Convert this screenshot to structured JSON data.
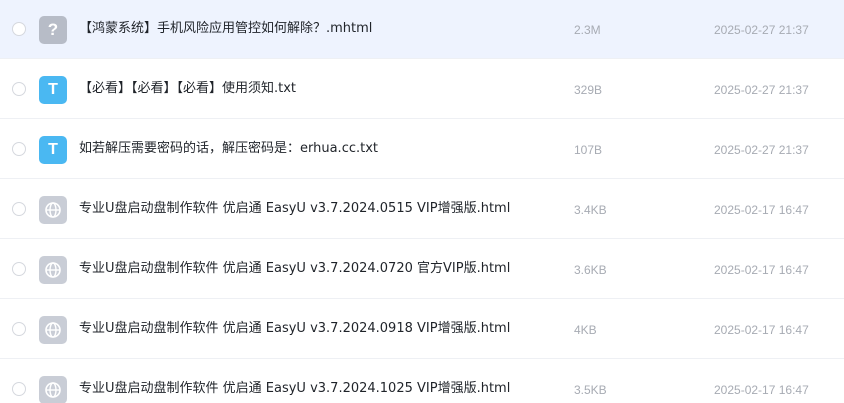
{
  "files": [
    {
      "name": "【鸿蒙系统】手机风险应用管控如何解除？.mhtml",
      "size": "2.3M",
      "date": "2025-02-27 21:37",
      "icon": "unknown-file-icon",
      "glyph": "?",
      "selected": true
    },
    {
      "name": "【必看】【必看】【必看】使用须知.txt",
      "size": "329B",
      "date": "2025-02-27 21:37",
      "icon": "text-file-icon",
      "glyph": "T",
      "selected": false
    },
    {
      "name": "如若解压需要密码的话，解压密码是：erhua.cc.txt",
      "size": "107B",
      "date": "2025-02-27 21:37",
      "icon": "text-file-icon",
      "glyph": "T",
      "selected": false
    },
    {
      "name": "专业U盘启动盘制作软件 优启通 EasyU v3.7.2024.0515 VIP增强版.html",
      "size": "3.4KB",
      "date": "2025-02-17 16:47",
      "icon": "web-file-icon",
      "glyph": "",
      "selected": false
    },
    {
      "name": "专业U盘启动盘制作软件 优启通 EasyU v3.7.2024.0720 官方VIP版.html",
      "size": "3.6KB",
      "date": "2025-02-17 16:47",
      "icon": "web-file-icon",
      "glyph": "",
      "selected": false
    },
    {
      "name": "专业U盘启动盘制作软件 优启通 EasyU v3.7.2024.0918 VIP增强版.html",
      "size": "4KB",
      "date": "2025-02-17 16:47",
      "icon": "web-file-icon",
      "glyph": "",
      "selected": false
    },
    {
      "name": "专业U盘启动盘制作软件 优启通 EasyU v3.7.2024.1025 VIP增强版.html",
      "size": "3.5KB",
      "date": "2025-02-17 16:47",
      "icon": "web-file-icon",
      "glyph": "",
      "selected": false
    }
  ]
}
